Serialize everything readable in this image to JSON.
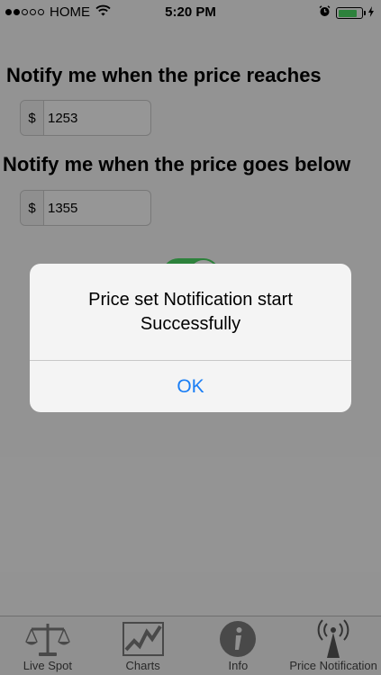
{
  "status": {
    "carrier": "HOME",
    "time": "5:20 PM",
    "signal_bars": 2,
    "battery_level": 0.8,
    "icons": [
      "wifi-icon",
      "alarm-icon",
      "battery-icon",
      "charging-icon"
    ]
  },
  "form": {
    "heading_reach": "Notify me when the price reaches",
    "currency_reach": "$",
    "value_reach": "1253",
    "heading_below": "Notify me when the price goes below",
    "currency_below": "$",
    "value_below": "1355",
    "toggle_on": true
  },
  "alert": {
    "message_line1": "Price set Notification start",
    "message_line2": "Successfully",
    "ok_label": "OK"
  },
  "tabs": [
    {
      "label": "Live Spot",
      "icon": "scales-icon"
    },
    {
      "label": "Charts",
      "icon": "chart-icon"
    },
    {
      "label": "Info",
      "icon": "info-icon"
    },
    {
      "label": "Price Notification",
      "icon": "antenna-icon"
    }
  ],
  "colors": {
    "toggle_on": "#4cd964",
    "battery": "#4cd964",
    "alert_button": "#1a7ef5"
  }
}
